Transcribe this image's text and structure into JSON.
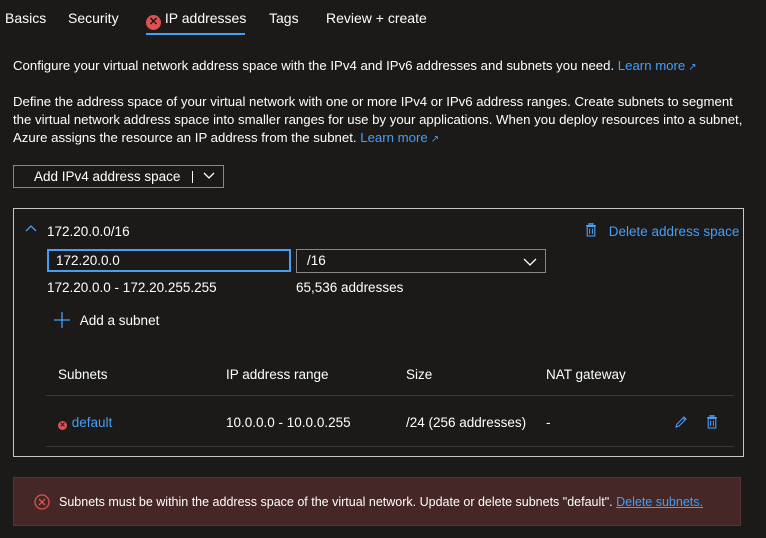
{
  "tabs": [
    {
      "label": "Basics",
      "active": false
    },
    {
      "label": "Security",
      "active": false
    },
    {
      "label": "IP addresses",
      "active": true,
      "has_error": true
    },
    {
      "label": "Tags",
      "active": false
    },
    {
      "label": "Review + create",
      "active": false
    }
  ],
  "intro": {
    "text": "Configure your virtual network address space with the IPv4 and IPv6 addresses and subnets you need.",
    "link": "Learn more"
  },
  "description": {
    "text": "Define the address space of your virtual network with one or more IPv4 or IPv6 address ranges. Create subnets to segment the virtual network address space into smaller ranges for use by your applications. When you deploy resources into a subnet, Azure assigns the resource an IP address from the subnet.",
    "link": "Learn more"
  },
  "add_button": {
    "label": "Add IPv4 address space"
  },
  "address_space": {
    "title": "172.20.0.0/16",
    "delete_label": "Delete address space",
    "input_value": "172.20.0.0",
    "prefix_selected": "/16",
    "range_text": "172.20.0.0 - 172.20.255.255",
    "count_text": "65,536 addresses",
    "add_subnet_label": "Add a subnet"
  },
  "subnets_table": {
    "columns": [
      "Subnets",
      "IP address range",
      "Size",
      "NAT gateway"
    ],
    "rows": [
      {
        "name": "default",
        "range": "10.0.0.0 - 10.0.0.255",
        "size": "/24 (256 addresses)",
        "nat": "-"
      }
    ]
  },
  "error_banner": {
    "text": "Subnets must be within the address space of the virtual network. Update or delete subnets \"default\".",
    "link": "Delete subnets."
  },
  "colors": {
    "background": "#1b1a19",
    "accent": "#479ef5",
    "error": "#e05050",
    "error_banner_bg": "#442726"
  }
}
